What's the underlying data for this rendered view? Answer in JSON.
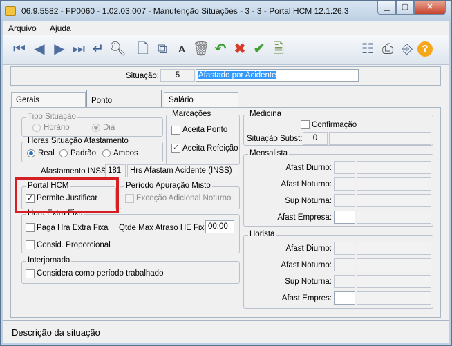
{
  "window": {
    "title": "06.9.5582 - FP0060 - 1.02.03.007 - Manutenção Situações - 3 - 3 - Portal HCM 12.1.26.3"
  },
  "menu": {
    "arquivo": "Arquivo",
    "ajuda": "Ajuda"
  },
  "situacao": {
    "label": "Situação:",
    "code": "5",
    "description": "Afastado por Acidente"
  },
  "tabs": {
    "gerais": "Gerais",
    "ponto": "Ponto",
    "salario": "Salário"
  },
  "tipo_situacao": {
    "title": "Tipo Situação",
    "horario": "Horário",
    "dia": "Dia",
    "selected": "Dia"
  },
  "horas_afastamento": {
    "title": "Horas Situação Afastamento",
    "real": "Real",
    "padrao": "Padrão",
    "ambos": "Ambos",
    "selected": "Real"
  },
  "marcacoes": {
    "title": "Marcações",
    "aceita_ponto": "Aceita Ponto",
    "aceita_ponto_checked": false,
    "aceita_refeicao": "Aceita Refeição",
    "aceita_refeicao_checked": true
  },
  "afastamento_inss": {
    "label": "Afastamento INSS:",
    "code": "181",
    "description": "Hrs Afastam Acidente (INSS)"
  },
  "portal_hcm": {
    "title": "Portal HCM",
    "permite_justificar": "Permite Justificar",
    "checked": true
  },
  "periodo_apuracao": {
    "title": "Período Apuração Misto",
    "excecao": "Exceção Adicional Noturno",
    "checked": false
  },
  "hora_extra": {
    "title": "Hora Extra Fixa",
    "paga": "Paga Hra Extra Fixa",
    "consid": "Consid. Proporcional",
    "qtde_label": "Qtde Max Atraso HE Fixa:",
    "qtde_value": "00:00"
  },
  "interjornada": {
    "title": "Interjornada",
    "considera": "Considera como período trabalhado"
  },
  "medicina": {
    "title": "Medicina",
    "confirmacao": "Confirmação",
    "situacao_subst_label": "Situação Subst:",
    "situacao_subst_value": "0"
  },
  "mensalista": {
    "title": "Mensalista",
    "rows": [
      "Afast Diurno:",
      "Afast Noturno:",
      "Sup Noturna:",
      "Afast Empresa:"
    ]
  },
  "horista": {
    "title": "Horista",
    "rows": [
      "Afast Diurno:",
      "Afast Noturno:",
      "Sup Noturna:",
      "Afast Empres:"
    ]
  },
  "status": {
    "text": "Descrição da situação"
  },
  "colors": {
    "highlight": "#d42025",
    "selection": "#3399ff"
  }
}
